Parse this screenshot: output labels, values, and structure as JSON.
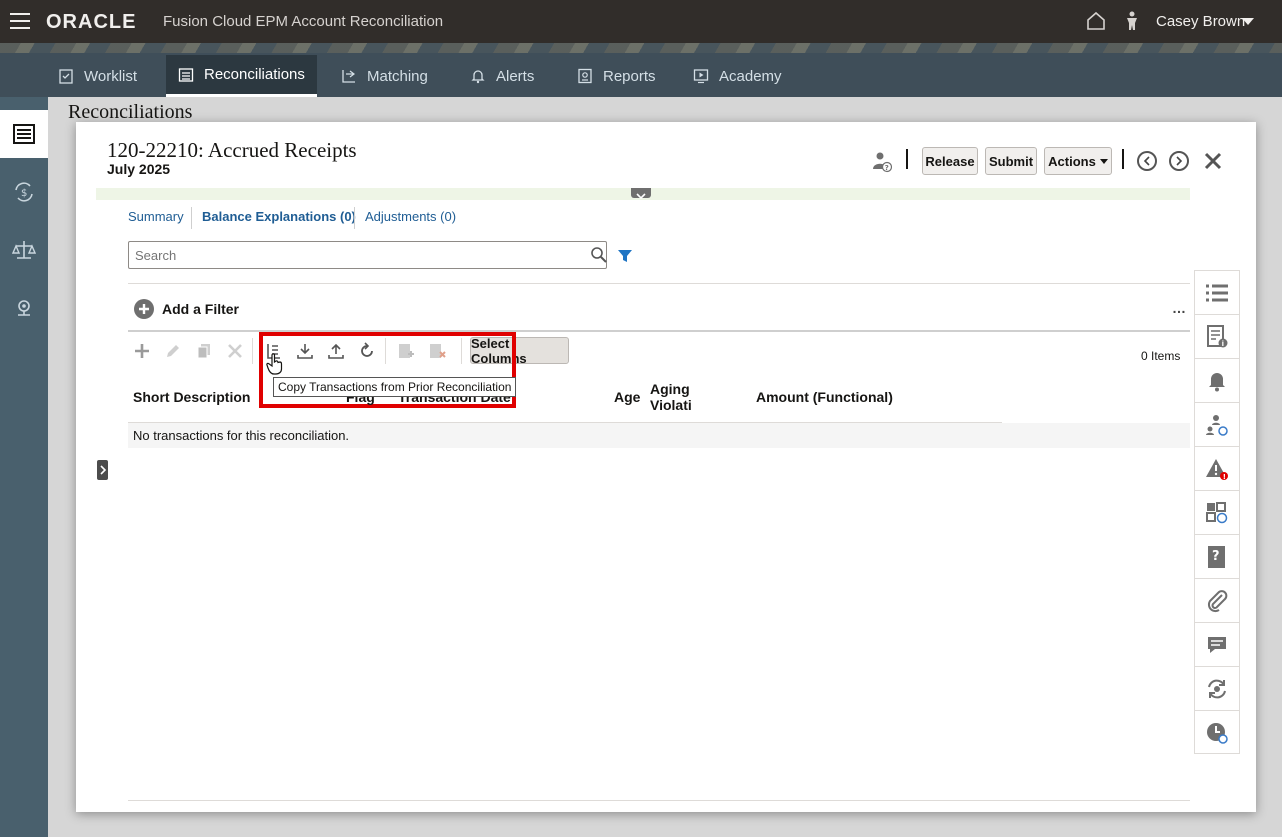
{
  "topbar": {
    "logo": "ORACLE",
    "app_title": "Fusion Cloud EPM Account Reconciliation",
    "user_name": "Casey Brown"
  },
  "nav": {
    "items": [
      {
        "label": "Worklist",
        "icon": "clipboard-icon"
      },
      {
        "label": "Reconciliations",
        "icon": "list-icon",
        "active": true
      },
      {
        "label": "Matching",
        "icon": "matching-icon"
      },
      {
        "label": "Alerts",
        "icon": "bell-icon"
      },
      {
        "label": "Reports",
        "icon": "report-icon"
      },
      {
        "label": "Academy",
        "icon": "play-icon"
      }
    ]
  },
  "background_page": {
    "title": "Reconciliations"
  },
  "dialog": {
    "title": "120-22210: Accrued Receipts",
    "period": "July 2025",
    "buttons": {
      "release": "Release",
      "submit": "Submit",
      "actions": "Actions"
    },
    "tabs": [
      {
        "label": "Summary"
      },
      {
        "label": "Balance Explanations (0)",
        "active": true
      },
      {
        "label": "Adjustments (0)"
      }
    ],
    "search_placeholder": "Search",
    "add_filter": "Add a Filter",
    "more": "…",
    "select_columns": "Select Columns",
    "items_count": "0 Items",
    "tooltip": "Copy Transactions from Prior Reconciliation",
    "columns": {
      "short_description": "Short Description",
      "flag": "Flag",
      "transaction_date": "Transaction Date",
      "age": "Age",
      "aging_violation": "Aging Violati",
      "amount_functional": "Amount (Functional)"
    },
    "empty_message": "No transactions for this reconciliation."
  },
  "colors": {
    "topbar": "#312d2a",
    "nav": "#3f4e59",
    "accent_link": "#1f5d94",
    "highlight": "#e00000"
  }
}
